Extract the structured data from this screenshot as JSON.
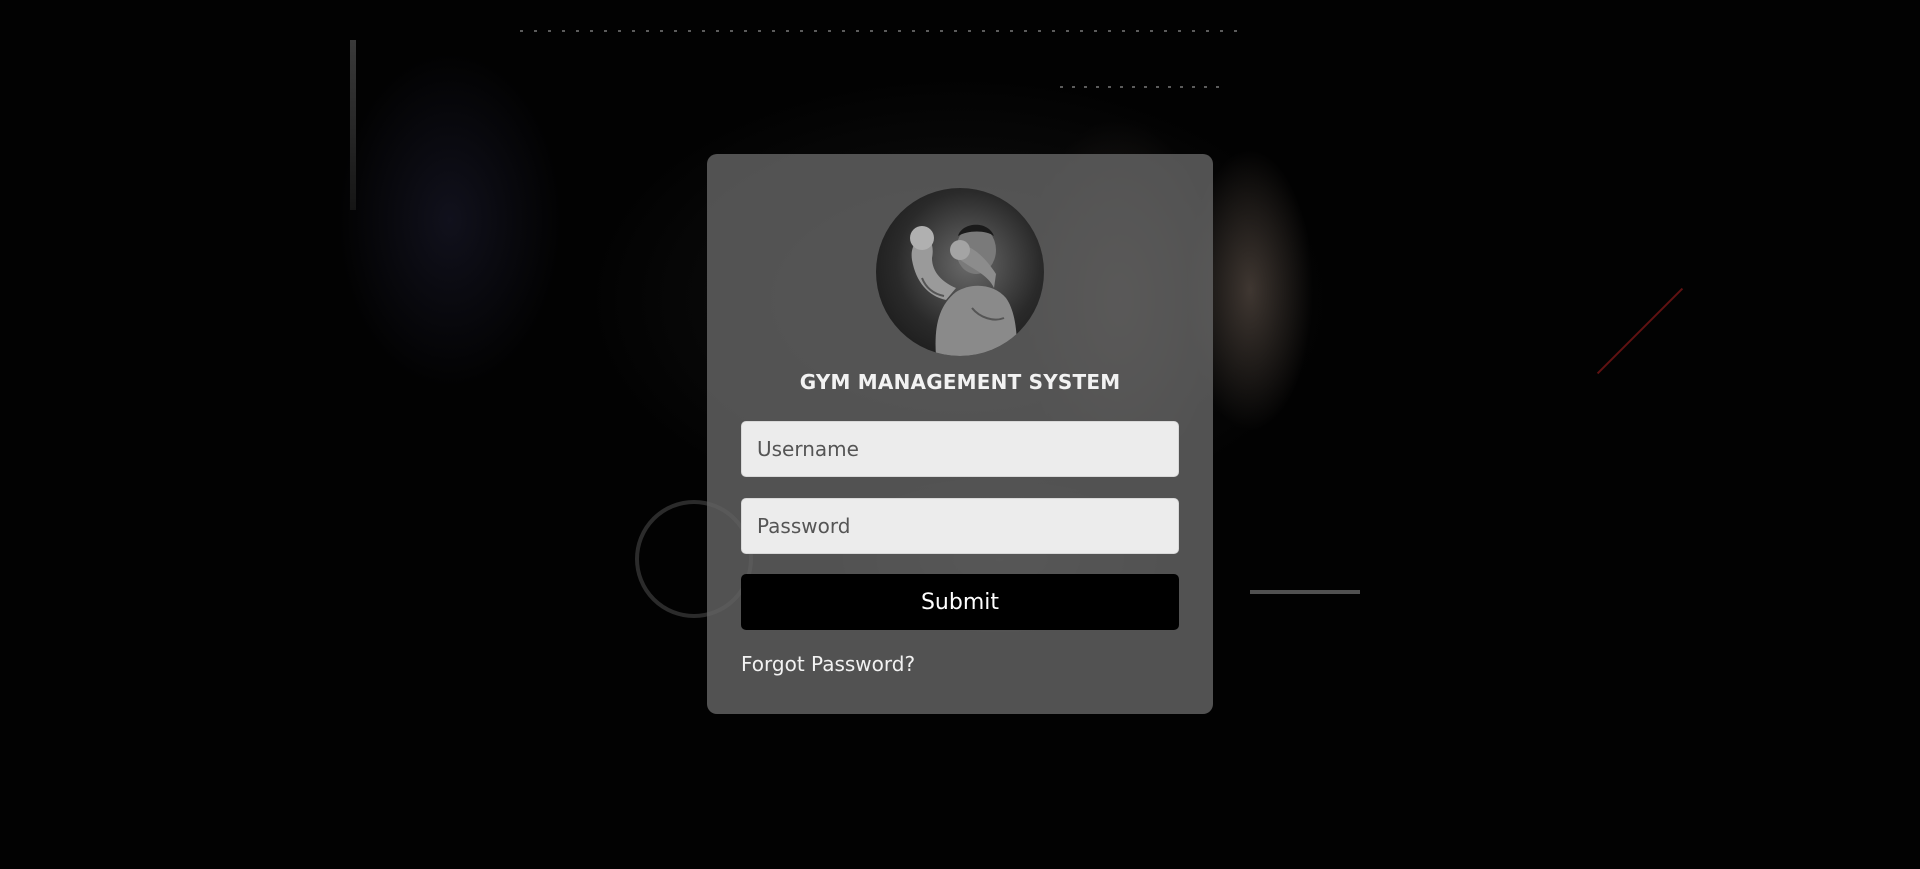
{
  "login": {
    "title": "GYM MANAGEMENT SYSTEM",
    "avatar_icon": "boxer-flexing-icon",
    "username": {
      "value": "",
      "placeholder": "Username"
    },
    "password": {
      "value": "",
      "placeholder": "Password"
    },
    "submit_label": "Submit",
    "forgot_label": "Forgot Password?"
  },
  "colors": {
    "background": "#020202",
    "card": "#646464",
    "button": "#000000",
    "input": "#ececec",
    "text": "#f2f2f2"
  }
}
